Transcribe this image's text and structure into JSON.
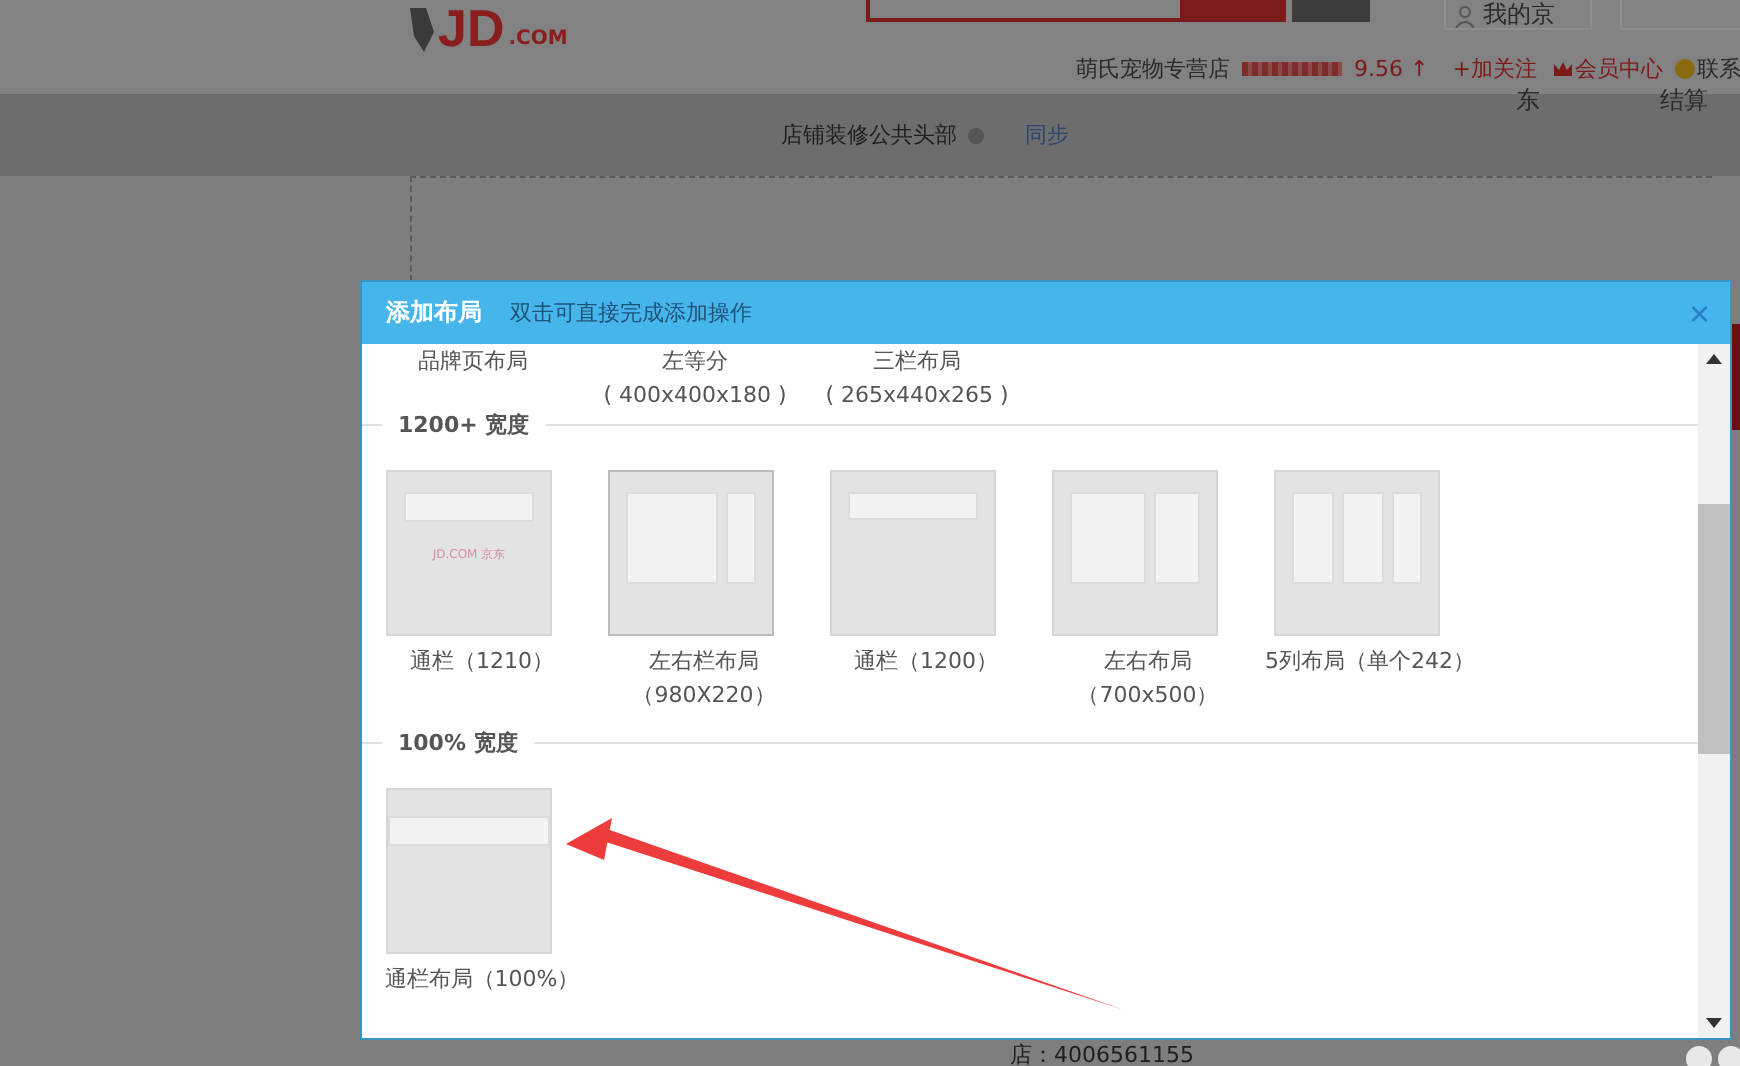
{
  "header": {
    "logo": {
      "mark": "JD",
      "domain": ".COM"
    },
    "account": "我的京",
    "account_tail": "东",
    "cart": "结算",
    "store_name": "萌氏宠物专营店",
    "score": "9.56",
    "score_trend": "↑",
    "follow": "+加关注",
    "member": "会员中心",
    "contact": "联系"
  },
  "edit_bar": {
    "title": "店铺装修公共头部",
    "sync": "同步"
  },
  "footer_phone": "店：4006561155",
  "dialog": {
    "title": "添加布局",
    "hint": "双击可直接完成添加操作",
    "close": "×",
    "partial_row": [
      {
        "name": "品牌页布局"
      },
      {
        "name": "左等分",
        "size": "( 400x400x180 )"
      },
      {
        "name": "三栏布局",
        "size": "( 265x440x265 )"
      }
    ],
    "sections": [
      {
        "title": "1200+ 宽度",
        "layouts": [
          {
            "kind": "banner-logo",
            "name": "通栏（1210）",
            "thumb_text": "JD.COM 京东"
          },
          {
            "kind": "main-side",
            "name": "左右栏布局",
            "size": "（980X220）"
          },
          {
            "kind": "banner",
            "name": "通栏（1200）"
          },
          {
            "kind": "two-col",
            "name": "左右布局",
            "size": "（700x500）"
          },
          {
            "kind": "three-col",
            "name": "5列布局（单个242）"
          }
        ]
      },
      {
        "title": "100% 宽度",
        "layouts": [
          {
            "kind": "full-banner",
            "name": "通栏布局（100%）"
          }
        ]
      }
    ]
  }
}
